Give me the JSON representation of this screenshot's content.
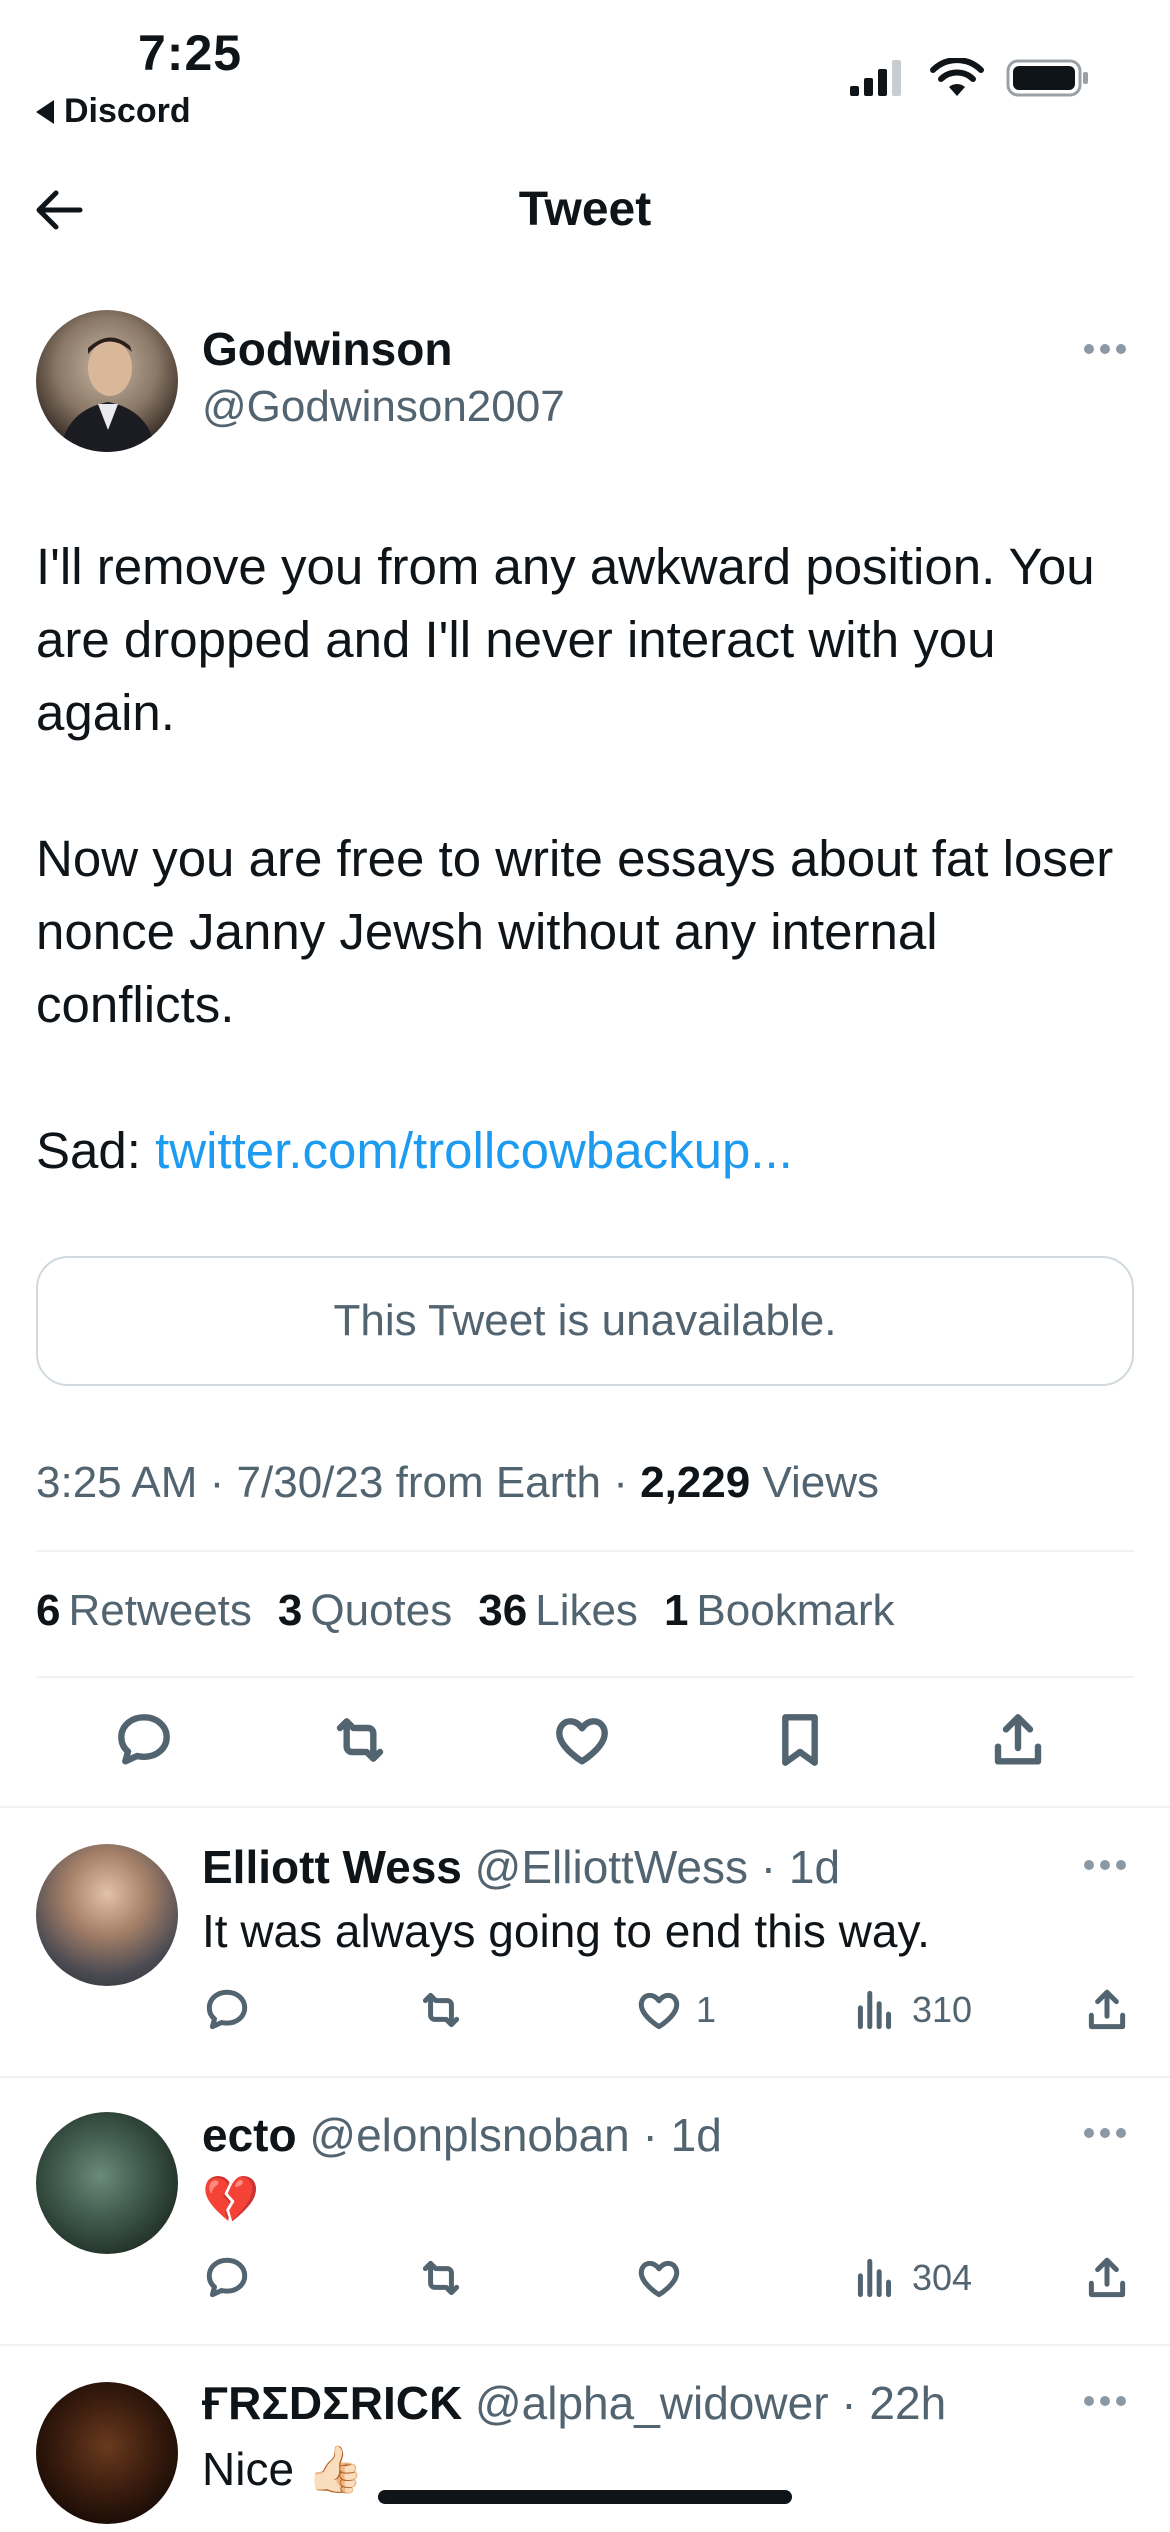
{
  "status_bar": {
    "time": "7:25",
    "back_app": "Discord"
  },
  "nav": {
    "title": "Tweet"
  },
  "tweet": {
    "author_name": "Godwinson",
    "author_handle": "@Godwinson2007",
    "text_p1": "I'll remove you from any awkward position. You are dropped and I'll never interact with you again.",
    "text_p2": "Now you are free to write essays about fat loser nonce Janny Jewsh without any internal conflicts.",
    "text_p3_prefix": "Sad: ",
    "text_p3_link": "twitter.com/trollcowbackup...",
    "quoted_unavailable": "This Tweet is unavailable.",
    "meta_time": "3:25 AM",
    "meta_date": "7/30/23",
    "meta_source": "from Earth",
    "views_count": "2,229",
    "views_label": "Views",
    "stats": [
      {
        "count": "6",
        "label": "Retweets"
      },
      {
        "count": "3",
        "label": "Quotes"
      },
      {
        "count": "36",
        "label": "Likes"
      },
      {
        "count": "1",
        "label": "Bookmark"
      }
    ]
  },
  "replies": [
    {
      "name": "Elliott Wess",
      "handle": "@ElliottWess",
      "age": "1d",
      "text": "It was always going to end this way.",
      "likes": "1",
      "views": "310"
    },
    {
      "name": "ecto",
      "handle": "@elonplsnoban",
      "age": "1d",
      "text": "💔",
      "likes": "",
      "views": "304"
    },
    {
      "name": "ҒRΣDΣRICƘ",
      "handle": "@alpha_widower",
      "age": "22h",
      "text": "Nice 👍🏻"
    }
  ],
  "colors": {
    "link": "#1d9bf0",
    "secondary_text": "#536471",
    "primary_text": "#0f1419",
    "border": "#cfd9de"
  }
}
